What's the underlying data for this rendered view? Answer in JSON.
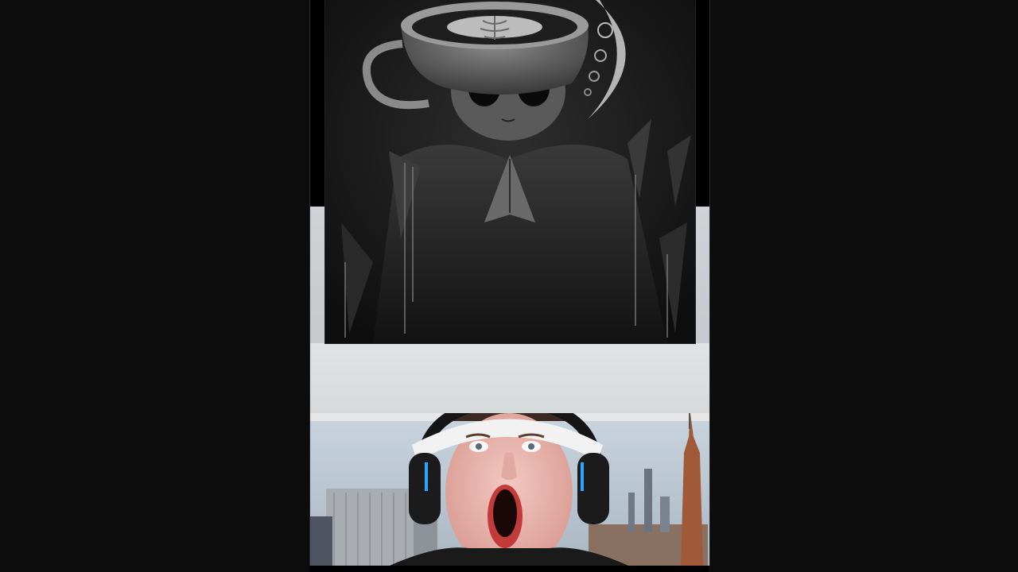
{
  "stream": {
    "artwork_subject": "coffee-cup-creature-drawing",
    "webcam_subject": "streamer-with-headband-reaction"
  },
  "colors": {
    "page_bg": "#0c0c0c",
    "frame_bg": "#000000",
    "headphone_accent": "#2aa8ff",
    "headband": "#f2f2f2"
  }
}
